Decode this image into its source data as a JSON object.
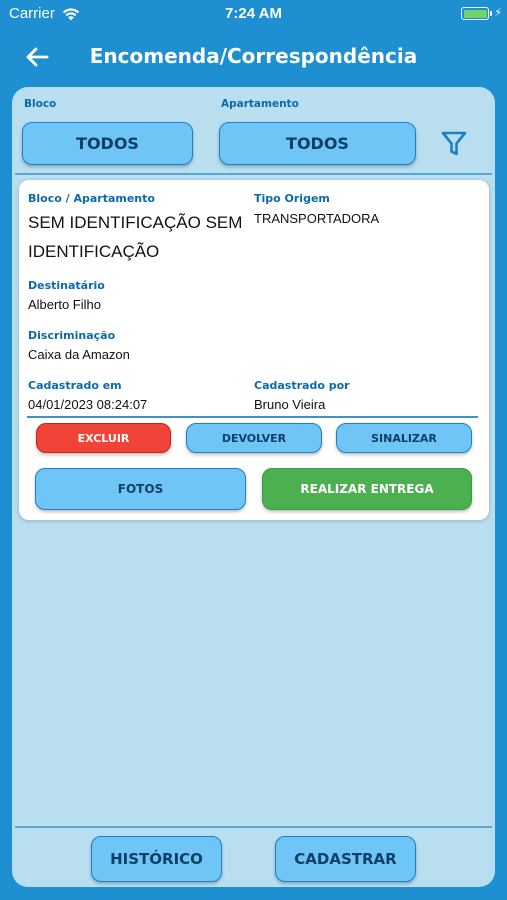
{
  "status_bar": {
    "carrier": "Carrier",
    "time": "7:24 AM",
    "battery_level": 1.0
  },
  "navbar": {
    "title": "Encomenda/Correspondência",
    "back_icon": "arrow-left-icon"
  },
  "filters": {
    "bloco_label": "Bloco",
    "bloco_value": "TODOS",
    "apartamento_label": "Apartamento",
    "apartamento_value": "TODOS",
    "filter_icon": "funnel-icon"
  },
  "card": {
    "bloco_apartamento_label": "Bloco / Apartamento",
    "bloco_apartamento_value": "SEM IDENTIFICAÇÃO SEM IDENTIFICAÇÃO",
    "tipo_origem_label": "Tipo Origem",
    "tipo_origem_value": "TRANSPORTADORA",
    "destinatario_label": "Destinatário",
    "destinatario_value": "Alberto Filho",
    "discriminacao_label": "Discriminação",
    "discriminacao_value": "Caixa da Amazon",
    "cadastrado_em_label": "Cadastrado em",
    "cadastrado_em_value": "04/01/2023 08:24:07",
    "cadastrado_por_label": "Cadastrado por",
    "cadastrado_por_value": "Bruno Vieira",
    "buttons": {
      "excluir": "EXCLUIR",
      "devolver": "DEVOLVER",
      "sinalizar": "SINALIZAR",
      "fotos": "FOTOS",
      "realizar_entrega": "REALIZAR ENTREGA"
    }
  },
  "bottom": {
    "historico": "HISTÓRICO",
    "cadastrar": "CADASTRAR"
  },
  "colors": {
    "background": "#1e8fd0",
    "panel": "#b8def0",
    "button": "#6fc6f6",
    "danger": "#f04438",
    "success": "#4caf50",
    "label": "#0b6aa8"
  }
}
